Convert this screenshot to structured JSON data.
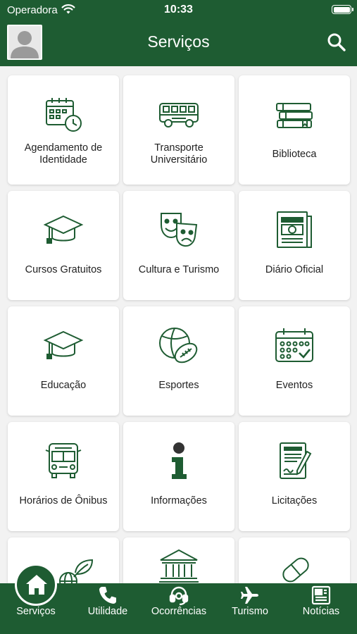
{
  "status": {
    "carrier": "Operadora",
    "time": "10:33"
  },
  "header": {
    "title": "Serviços",
    "search_icon": "search-icon",
    "avatar_icon": "user-avatar"
  },
  "colors": {
    "primary": "#1e5c32",
    "background": "#f2f2f2",
    "card": "#ffffff"
  },
  "services": [
    {
      "label": "Agendamento de Identidade",
      "icon": "calendar-clock-icon"
    },
    {
      "label": "Transporte Universitário",
      "icon": "bus-icon"
    },
    {
      "label": "Biblioteca",
      "icon": "books-icon"
    },
    {
      "label": "Cursos Gratuitos",
      "icon": "graduation-cap-icon"
    },
    {
      "label": "Cultura e Turismo",
      "icon": "theater-masks-icon"
    },
    {
      "label": "Diário Oficial",
      "icon": "newspaper-icon"
    },
    {
      "label": "Educação",
      "icon": "graduation-cap-icon"
    },
    {
      "label": "Esportes",
      "icon": "sports-balls-icon"
    },
    {
      "label": "Eventos",
      "icon": "calendar-check-icon"
    },
    {
      "label": "Horários de Ônibus",
      "icon": "bus-front-icon"
    },
    {
      "label": "Informações",
      "icon": "info-icon"
    },
    {
      "label": "Licitações",
      "icon": "contract-icon"
    },
    {
      "label": "",
      "icon": "globe-leaf-icon"
    },
    {
      "label": "",
      "icon": "bank-building-icon"
    },
    {
      "label": "",
      "icon": "pills-icon"
    }
  ],
  "nav": [
    {
      "label": "Serviços",
      "icon": "home-icon",
      "active": true
    },
    {
      "label": "Utilidade",
      "icon": "phone-icon"
    },
    {
      "label": "Ocorrências",
      "icon": "headset-icon"
    },
    {
      "label": "Turismo",
      "icon": "airplane-icon"
    },
    {
      "label": "Notícias",
      "icon": "news-icon"
    }
  ]
}
